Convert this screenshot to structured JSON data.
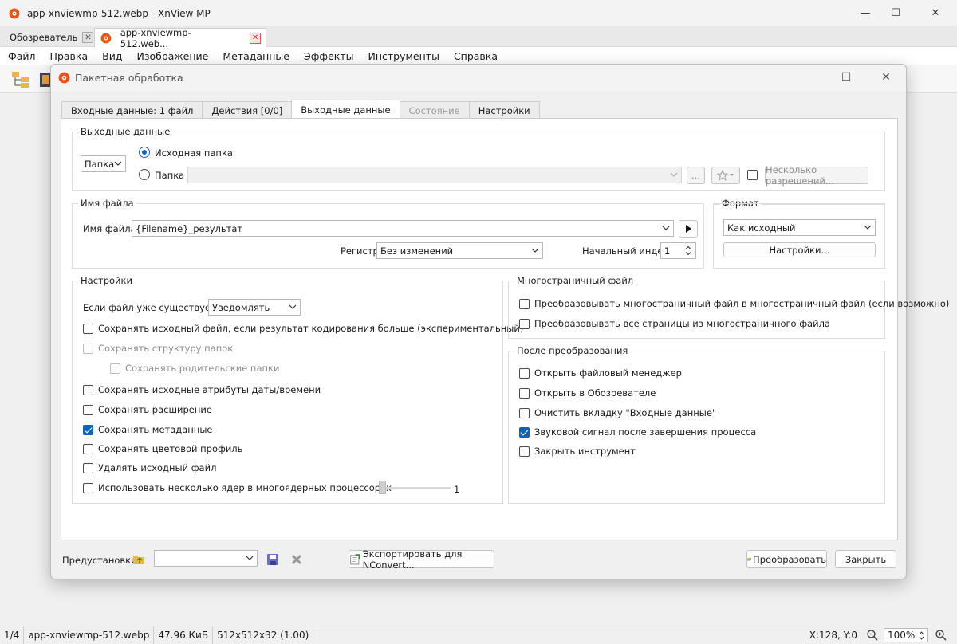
{
  "window": {
    "title": "app-xnviewmp-512.webp - XnView MP",
    "minimize_glyph": "—",
    "maximize_glyph": "☐",
    "close_glyph": "✕"
  },
  "tabs": [
    {
      "label": "Обозреватель",
      "close_glyph": "✕"
    },
    {
      "label": "app-xnviewmp-512.web...",
      "close_glyph": "✕"
    }
  ],
  "menu": [
    "Файл",
    "Правка",
    "Вид",
    "Изображение",
    "Метаданные",
    "Эффекты",
    "Инструменты",
    "Справка"
  ],
  "dialog": {
    "title": "Пакетная обработка",
    "maximize_glyph": "☐",
    "close_glyph": "✕",
    "tabs": [
      {
        "label": "Входные данные: 1 файл",
        "state": "normal"
      },
      {
        "label": "Действия [0/0]",
        "state": "normal"
      },
      {
        "label": "Выходные данные",
        "state": "active"
      },
      {
        "label": "Состояние",
        "state": "disabled"
      },
      {
        "label": "Настройки",
        "state": "normal"
      }
    ],
    "output": {
      "legend": "Выходные данные",
      "dest_combo": "Папка",
      "radio_source": "Исходная папка",
      "radio_folder": "Папка",
      "folder_path": "",
      "browse_label": "...",
      "multi_res_label": "Несколько разрешений..."
    },
    "filename": {
      "legend": "Имя файла",
      "label": "Имя файла",
      "value": "{Filename}_результат",
      "register_label": "Регистр",
      "register_value": "Без изменений",
      "start_index_label": "Начальный индекс",
      "start_index_value": "1"
    },
    "format": {
      "legend": "Формат",
      "value": "Как исходный",
      "settings_button": "Настройки..."
    },
    "settings": {
      "legend": "Настройки",
      "exists_label": "Если файл уже существует, то",
      "exists_value": "Уведомлять",
      "options": [
        {
          "label": "Сохранять исходный файл, если результат кодирования больше (экспериментальный)",
          "checked": false,
          "disabled": false
        },
        {
          "label": "Сохранять структуру папок",
          "checked": false,
          "disabled": true
        },
        {
          "label": "Сохранять родительские папки",
          "checked": false,
          "disabled": true
        },
        {
          "label": "Сохранять исходные атрибуты даты/времени",
          "checked": false,
          "disabled": false
        },
        {
          "label": "Сохранять расширение",
          "checked": false,
          "disabled": false
        },
        {
          "label": "Сохранять метаданные",
          "checked": true,
          "disabled": false
        },
        {
          "label": "Сохранять цветовой профиль",
          "checked": false,
          "disabled": false
        },
        {
          "label": "Удалять исходный файл",
          "checked": false,
          "disabled": false
        },
        {
          "label": "Использовать несколько ядер в многоядерных процессорах",
          "checked": false,
          "disabled": false
        }
      ],
      "cores_value": "1"
    },
    "multipage": {
      "legend": "Многостраничный файл",
      "options": [
        {
          "label": "Преобразовывать многостраничный файл в многостраничный файл (если возможно)",
          "checked": false
        },
        {
          "label": "Преобразовывать все страницы из многостраничного файла",
          "checked": false
        }
      ]
    },
    "after": {
      "legend": "После преобразования",
      "options": [
        {
          "label": "Открыть файловый менеджер",
          "checked": false
        },
        {
          "label": "Открыть в Обозревателе",
          "checked": false
        },
        {
          "label": "Очистить вкладку \"Входные данные\"",
          "checked": false
        },
        {
          "label": "Звуковой сигнал после завершения процесса",
          "checked": true
        },
        {
          "label": "Закрыть инструмент",
          "checked": false
        }
      ]
    },
    "footer": {
      "presets_label": "Предустановки:",
      "presets_value": "",
      "export_button": "Экспортировать для NConvert...",
      "convert_button": "Преобразовать",
      "close_button": "Закрыть"
    }
  },
  "status": {
    "index": "1/4",
    "filename": "app-xnviewmp-512.webp",
    "size": "47.96 КиБ",
    "dimensions": "512x512x32 (1.00)",
    "coords": "X:128, Y:0",
    "zoom": "100%",
    "zoom_out_glyph": "−",
    "zoom_in_glyph": "+"
  },
  "colors": {
    "accent": "#0f64b8",
    "logo": "#e8541b"
  }
}
